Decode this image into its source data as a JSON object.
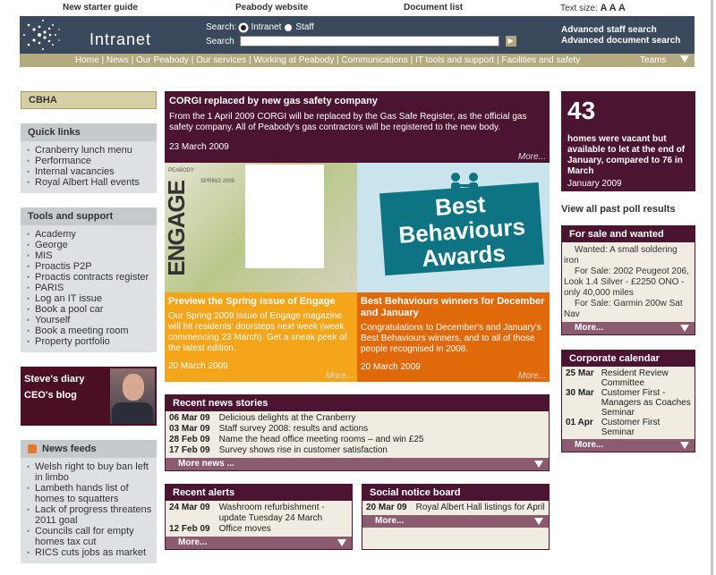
{
  "top_links": {
    "starter": "New starter guide",
    "peabody": "Peabody website",
    "docs": "Document list",
    "textsize": "Text size:",
    "textsize_a": "A A A"
  },
  "header": {
    "logo": "Intranet",
    "search_label1": "Search:",
    "radio_intranet": "Intranet",
    "radio_staff": "Staff",
    "search_label2": "Search",
    "go": "▶",
    "adv1": "Advanced staff search",
    "adv2": "Advanced document search"
  },
  "nav": {
    "home": "Home",
    "items": " | News | Our Peabody | Our services | Working at Peabody | Communications | IT tools and support | Facilities and safety",
    "teams": "Teams"
  },
  "sidebar": {
    "cbha": "CBHA",
    "quick_title": "Quick links",
    "quick": [
      "Cranberry lunch menu",
      "Performance",
      "Internal vacancies",
      "Royal Albert Hall events"
    ],
    "tools_title": "Tools and support",
    "tools": [
      "Academy",
      "George",
      "MIS",
      "Proactis P2P",
      "Proactis contracts register",
      "PARIS",
      "Log an IT issue",
      "Book a pool car",
      "Yourself",
      "Book a meeting room",
      "Property portfolio"
    ],
    "steve1": "Steve's diary",
    "steve2": "CEO's blog",
    "feeds_title": "News feeds",
    "feeds": [
      "Welsh right to buy ban left in limbo",
      "Lambeth hands list of homes to squatters",
      "Lack of progress threatens 2011 goal",
      "Councils call for empty homes tax cut",
      "RICS cuts jobs as market"
    ]
  },
  "main": {
    "corgi_title": "CORGI replaced by new gas safety company",
    "corgi_text": "From the 1 April 2009 CORGI will be replaced by the Gas Safe Register, as the official gas safety company. All of Peabody's gas contractors will be registered to the new body.",
    "corgi_date": "23 March 2009",
    "more": "More...",
    "engage_vert": "ENGAGE",
    "engage_brand": "PEABODY",
    "engage_issue": "SPRING 2009",
    "awards": "Best Behaviours Awards",
    "engage_title": "Preview the Spring issue of Engage",
    "engage_text": "Our Spring 2009 issue of Engage magazine will hit residents' doorsteps next week (week commencing 23 March). Get a sneak peek of the latest edition.",
    "engage_date": "20 March 2009",
    "bb_title": "Best Behaviours winners for December and January",
    "bb_text": "Congratulations to December's and January's Best Behaviours winners, and to all of those people recognised in 2008.",
    "bb_date": "20 March 2009",
    "news_title": "Recent news stories",
    "news": [
      [
        "06 Mar 09",
        "Delicious delights at the Cranberry"
      ],
      [
        "03 Mar 09",
        "Staff survey 2008: results and actions"
      ],
      [
        "28 Feb 09",
        "Name the head office meeting rooms – and win £25"
      ],
      [
        "17 Feb 09",
        "Survey shows rise in customer satisfaction"
      ]
    ],
    "news_more": "More news ...",
    "alerts_title": "Recent alerts",
    "alerts": [
      [
        "24 Mar 09",
        "Washroom refurbishment - update Tuesday 24 March"
      ],
      [
        "12 Feb 09",
        "Office moves"
      ]
    ],
    "alerts_more": "More...",
    "social_title": "Social notice board",
    "social": [
      [
        "20 Mar 09",
        "Royal Albert Hall listings for April"
      ]
    ],
    "social_more": "More..."
  },
  "right": {
    "poll_num": "43",
    "poll_text": "homes were vacant but available to let at the end of January, compared to 76 in March",
    "poll_date": "January 2009",
    "past": "View all past poll results",
    "sale_title": "For sale and wanted",
    "sale": [
      "Wanted: A small soldering iron",
      "For Sale: 2002 Peugeot 206, Look 1.4 Silver - £2250 ONO - only 40,000 miles",
      "For Sale: Garmin 200w Sat Nav"
    ],
    "sale_more": "More...",
    "cal_title": "Corporate calendar",
    "cal": [
      [
        "25 Mar",
        "Resident Review Committee"
      ],
      [
        "30 Mar",
        "Customer First - Managers as Coaches Seminar"
      ],
      [
        "01 Apr",
        "Customer First Seminar"
      ]
    ],
    "cal_more": "More..."
  },
  "colors": {
    "plum": "#4b1431",
    "khaki": "#b3aa80",
    "navy": "#3a4a5c",
    "orange": "#f4a51a",
    "darkorange": "#e06a0a",
    "teal": "#0e7382"
  }
}
